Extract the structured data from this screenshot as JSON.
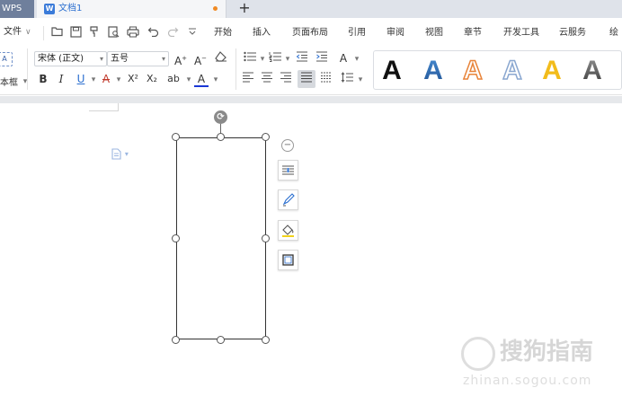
{
  "tabs": {
    "app": "WPS",
    "doc_icon": "W",
    "doc_name": "文档1",
    "new_tab": "+"
  },
  "menu": {
    "file": "文件",
    "file_chevron": "∨",
    "quick_access": [
      "open-icon",
      "save-icon",
      "format-painter-icon",
      "print-preview-icon",
      "print-icon",
      "undo-icon",
      "redo-icon",
      "customize-icon"
    ],
    "items": [
      "开始",
      "插入",
      "页面布局",
      "引用",
      "审阅",
      "视图",
      "章节",
      "开发工具",
      "云服务",
      "绘"
    ]
  },
  "ribbon": {
    "textbox_glyph": "A",
    "textbox_label": "本框",
    "font_name": "宋体 (正文)",
    "font_size": "五号",
    "grow_font": "A",
    "shrink_font": "A",
    "clear_format": "◇",
    "bold": "B",
    "italic": "I",
    "underline": "U",
    "strikethrough": "A",
    "superscript": "X²",
    "subscript": "X₂",
    "pinyin": "ab",
    "font_color": "A",
    "text_effect": "A",
    "style_previews": [
      {
        "label": "A",
        "color": "#111111",
        "style": "solid"
      },
      {
        "label": "A",
        "color": "#4a8fd6",
        "style": "gradient"
      },
      {
        "label": "A",
        "color": "#e8843a",
        "style": "outline"
      },
      {
        "label": "A",
        "color": "#8aa7d0",
        "style": "outline"
      },
      {
        "label": "A",
        "color": "#f2bc1b",
        "style": "solid"
      },
      {
        "label": "A",
        "color": "#555555",
        "style": "gradient"
      }
    ],
    "accent_color": "#2b6fd0"
  },
  "document": {
    "paragraph_icon": "📄",
    "paragraph_menu_arrow": "▾",
    "rotate_glyph": "⟳",
    "collapse_glyph": "−",
    "float_toolbar": [
      "layout-options-icon",
      "pen-style-icon",
      "fill-icon",
      "border-icon"
    ]
  },
  "watermark": {
    "text": "搜狗指南",
    "sub": "zhinan.sogou.com"
  }
}
